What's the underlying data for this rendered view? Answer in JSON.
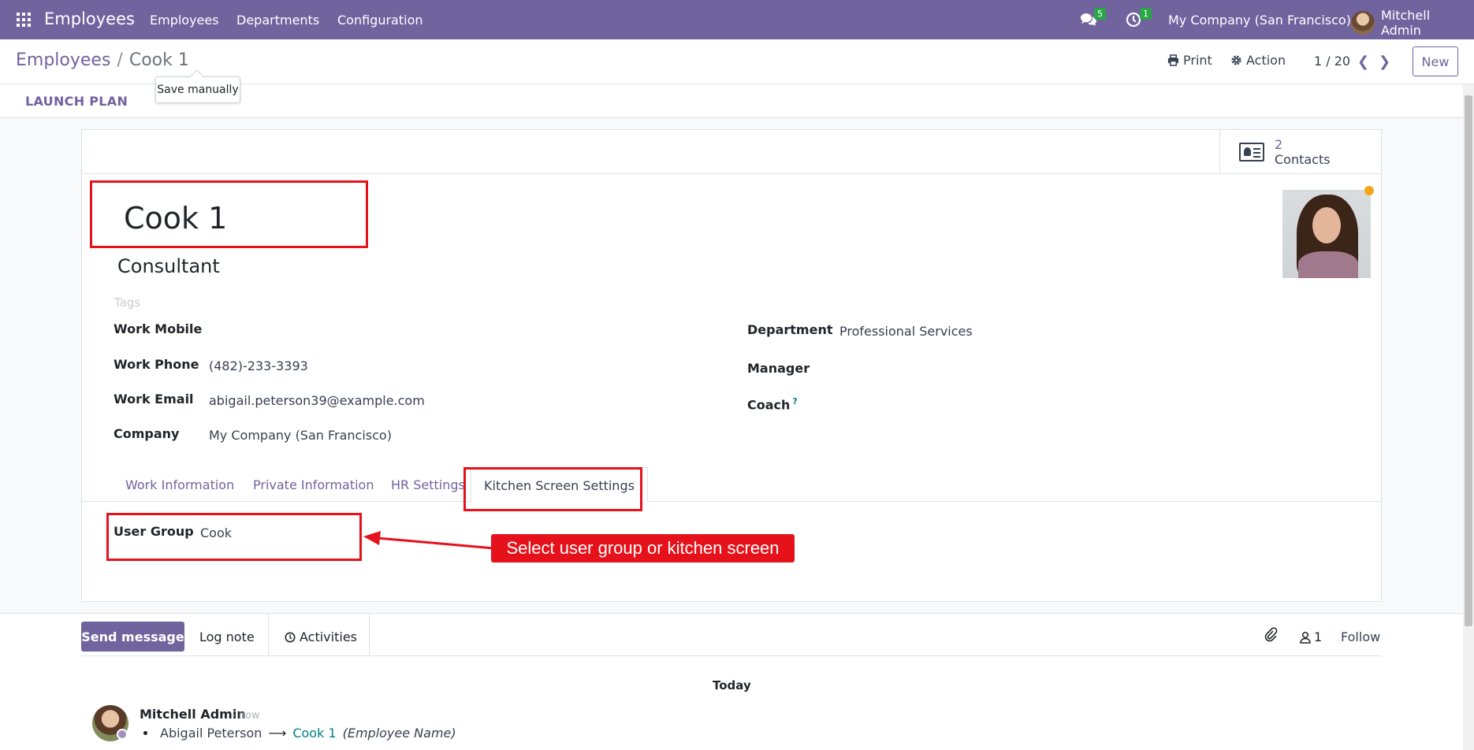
{
  "navbar": {
    "brand": "Employees",
    "menus": [
      "Employees",
      "Departments",
      "Configuration"
    ],
    "messages_count": "5",
    "activities_count": "1",
    "company": "My Company (San Francisco)",
    "user": "Mitchell Admin"
  },
  "control": {
    "breadcrumb_parent": "Employees",
    "breadcrumb_sep": "/",
    "breadcrumb_current": "Cook 1",
    "tooltip": "Save manually",
    "print": "Print",
    "action": "Action",
    "pager": "1 / 20",
    "new": "New"
  },
  "statusbar": {
    "launch_plan": "LAUNCH PLAN"
  },
  "smart_button": {
    "count": "2",
    "label": "Contacts"
  },
  "employee": {
    "name": "Cook 1",
    "job_title": "Consultant",
    "tags_placeholder": "Tags"
  },
  "fields_left": [
    {
      "label": "Work Mobile",
      "value": ""
    },
    {
      "label": "Work Phone",
      "value": "(482)-233-3393"
    },
    {
      "label": "Work Email",
      "value": "abigail.peterson39@example.com"
    },
    {
      "label": "Company",
      "value": "My Company (San Francisco)"
    }
  ],
  "fields_right": [
    {
      "label": "Department",
      "value": "Professional Services"
    },
    {
      "label": "Manager",
      "value": ""
    },
    {
      "label": "Coach",
      "value": "",
      "help": "?"
    }
  ],
  "tabs": [
    "Work Information",
    "Private Information",
    "HR Settings",
    "Kitchen Screen Settings"
  ],
  "kitchen": {
    "label": "User Group",
    "value": "Cook"
  },
  "annotation": {
    "text": "Select user group or kitchen screen",
    "color": "#e5121b"
  },
  "chatter": {
    "send_message": "Send message",
    "log_note": "Log note",
    "activities": "Activities",
    "followers_count": "1",
    "follow": "Follow",
    "day": "Today",
    "author": "Mitchell Admin",
    "time": "- now",
    "old_value": "Abigail Peterson",
    "new_value": "Cook 1",
    "field": "(Employee Name)"
  },
  "colors": {
    "brand": "#71639e",
    "link": "#017e84",
    "badge": "#28a745",
    "accent_dot": "#f3a41b"
  }
}
